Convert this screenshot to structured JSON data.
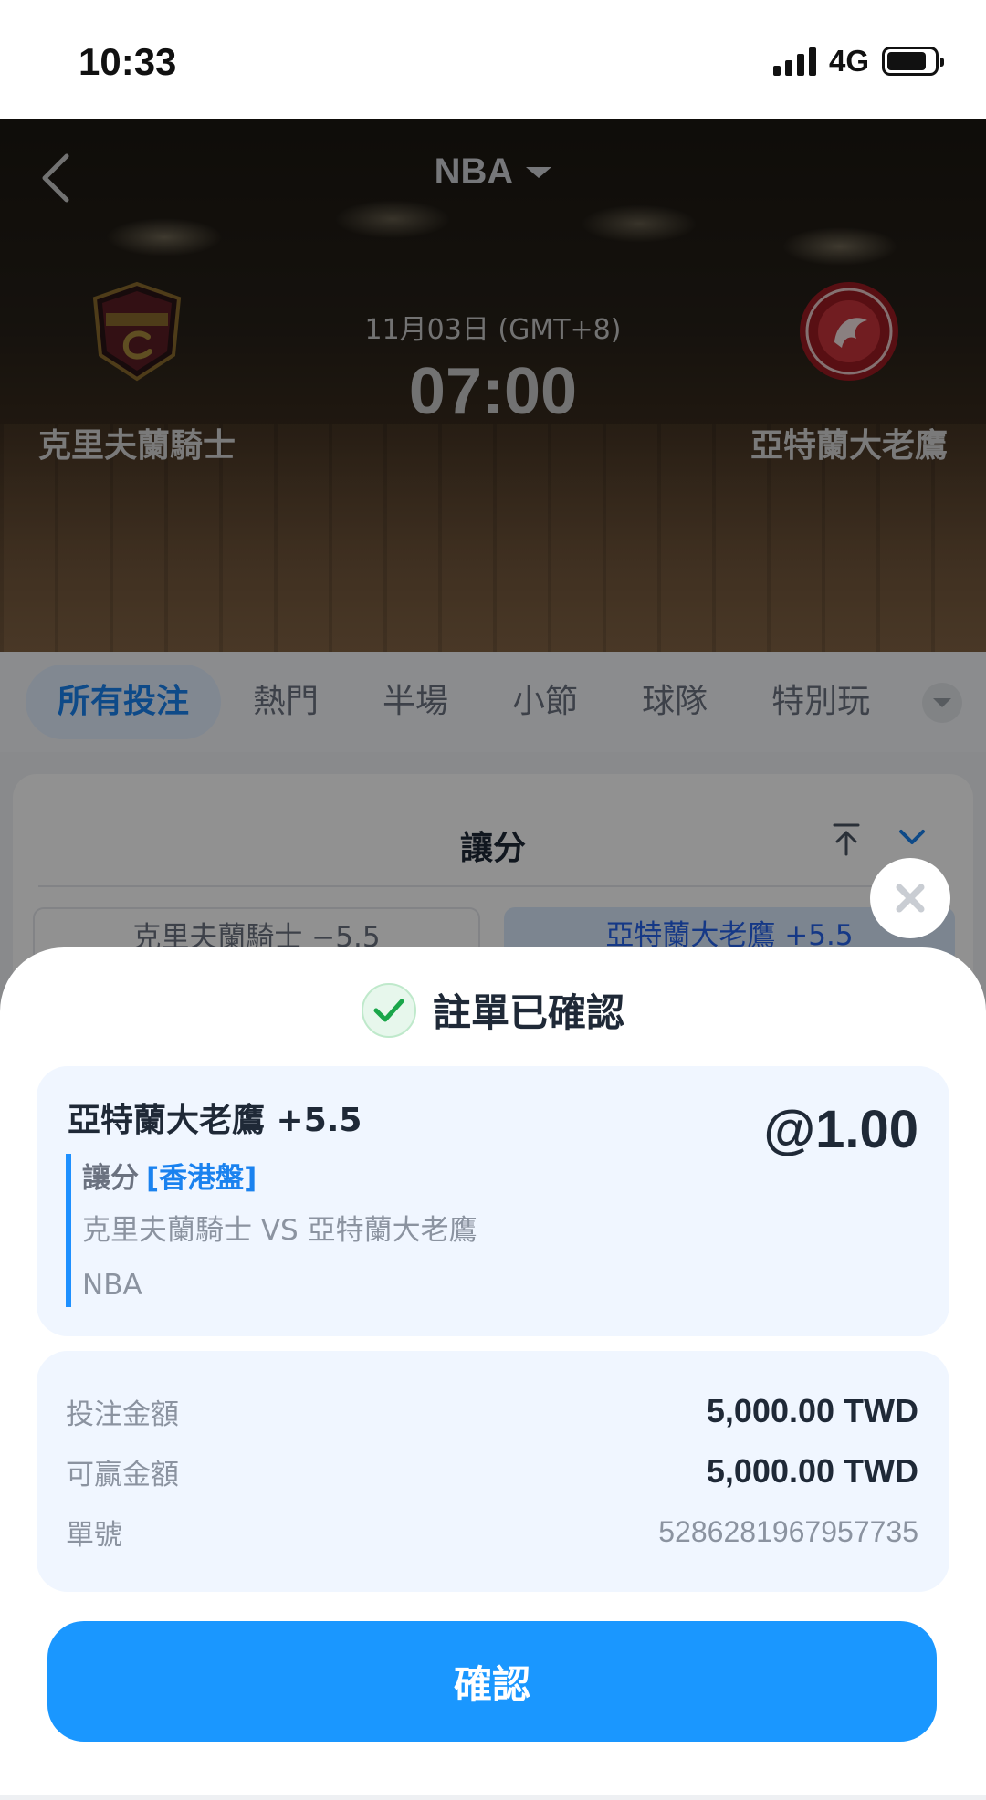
{
  "status_bar": {
    "time": "10:33",
    "network": "4G"
  },
  "header": {
    "league": "NBA"
  },
  "match": {
    "home_team": "克里夫蘭騎士",
    "away_team": "亞特蘭大老鷹",
    "date": "11月03日 (GMT+8)",
    "time": "07:00"
  },
  "tabs": [
    {
      "label": "所有投注"
    },
    {
      "label": "熱門"
    },
    {
      "label": "半場"
    },
    {
      "label": "小節"
    },
    {
      "label": "球隊"
    },
    {
      "label": "特別玩"
    }
  ],
  "market": {
    "title": "讓分",
    "home_option": "克里夫蘭騎士 −5.5",
    "away_option": "亞特蘭大老鷹 +5.5"
  },
  "sheet": {
    "title": "註單已確認",
    "bet": {
      "selection": "亞特蘭大老鷹 +5.5",
      "odds": "@1.00",
      "market": "讓分",
      "market_type": "[香港盤]",
      "match": "克里夫蘭騎士 VS 亞特蘭大老鷹",
      "league": "NBA"
    },
    "info": [
      {
        "label": "投注金額",
        "value": "5,000.00 TWD"
      },
      {
        "label": "可贏金額",
        "value": "5,000.00 TWD"
      },
      {
        "label": "單號",
        "value": "5286281967957735"
      }
    ],
    "confirm_label": "確認"
  },
  "colors": {
    "accent": "#1a97ff",
    "active_tab_text": "#1a82ef",
    "success": "#1aa64a"
  }
}
